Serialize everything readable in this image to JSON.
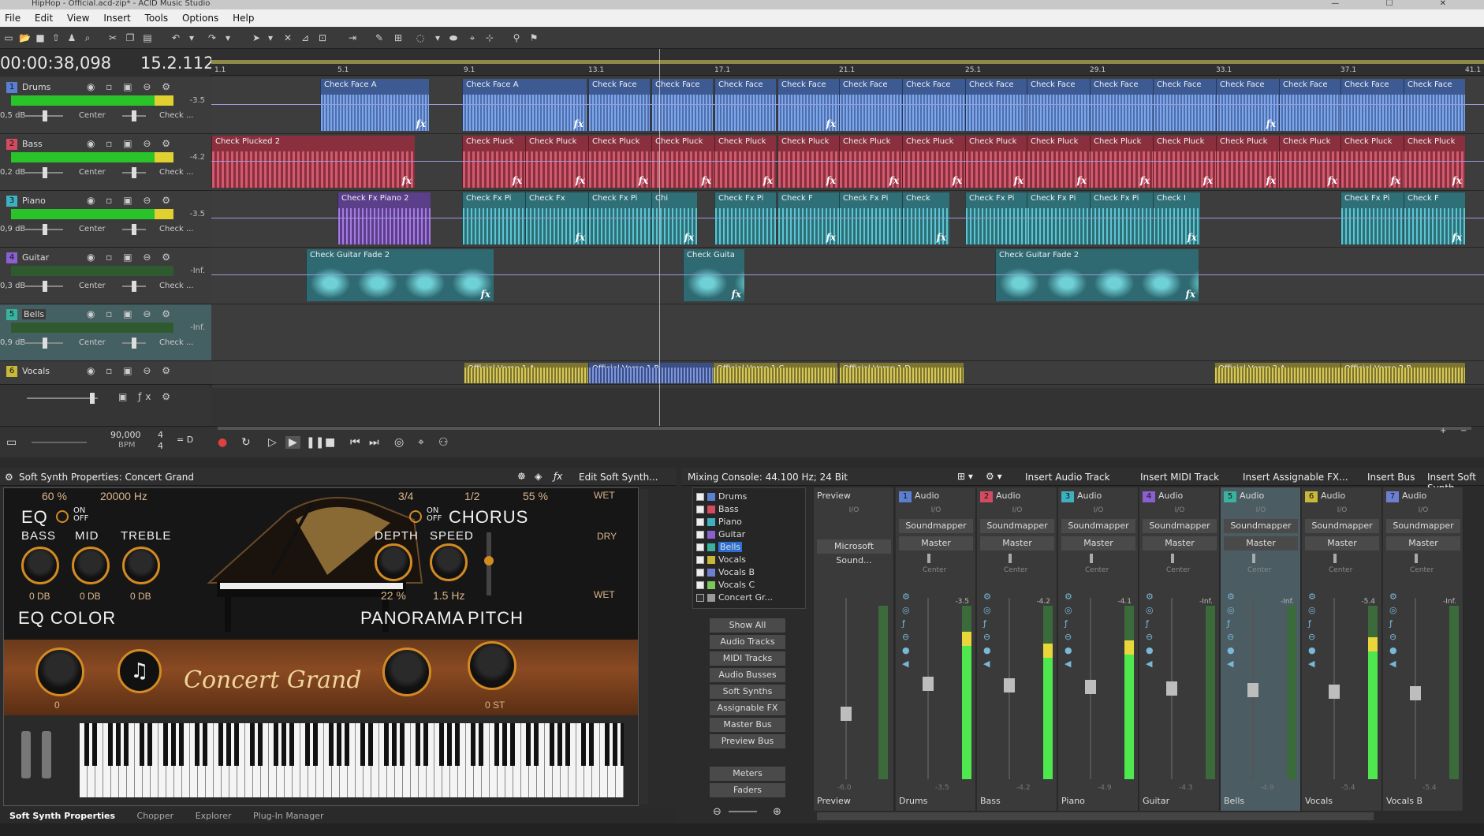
{
  "title_bar": {
    "title": "HipHop - Official.acd-zip* - ACID Music Studio",
    "window_controls": "— ☐ ✕"
  },
  "menu": [
    "File",
    "Edit",
    "View",
    "Insert",
    "Tools",
    "Options",
    "Help"
  ],
  "timeline": {
    "timecode": "00:00:38,098",
    "measure": "15.2.112",
    "ruler": [
      "1.1",
      "5.1",
      "9.1",
      "13.1",
      "17.1",
      "21.1",
      "25.1",
      "29.1",
      "33.1",
      "37.1",
      "41.1"
    ]
  },
  "tracks": [
    {
      "num": "1",
      "name": "Drums",
      "color": "#5a7fd1",
      "db": "0,5 dB",
      "peak": "-3.5",
      "pan": "Center",
      "fx": "Check ..."
    },
    {
      "num": "2",
      "name": "Bass",
      "color": "#d24b60",
      "db": "0,2 dB",
      "peak": "-4.2",
      "pan": "Center",
      "fx": "Check ..."
    },
    {
      "num": "3",
      "name": "Piano",
      "color": "#3fb0be",
      "db": "0,9 dB",
      "peak": "-3.5",
      "pan": "Center",
      "fx": "Check ..."
    },
    {
      "num": "4",
      "name": "Guitar",
      "color": "#8a5fd0",
      "db": "0,3 dB",
      "peak": "-Inf.",
      "pan": "Center",
      "fx": "Check ..."
    },
    {
      "num": "5",
      "name": "Bells",
      "color": "#3ab2a0",
      "db": "0,9 dB",
      "peak": "-Inf.",
      "pan": "Center",
      "fx": "Check ..."
    },
    {
      "num": "6",
      "name": "Vocals",
      "color": "#c8b83a",
      "db": "",
      "peak": "",
      "pan": "",
      "fx": ""
    }
  ],
  "clips": {
    "drums": [
      "Check Face A",
      "Check Face A",
      "Check Face",
      "Check Face",
      "Check Face",
      "Check Face",
      "Check Face",
      "Check Face",
      "Check Face",
      "Check Face",
      "Check Face",
      "Check Face",
      "Check Face",
      "Check Face",
      "Check Face",
      "Check Face",
      "Check Face"
    ],
    "bass": [
      "Check Plucked 2",
      "Check Pluck",
      "Check Pluck",
      "Check Pluck",
      "Check Pluck",
      "Check Pluck",
      "Check Pluck",
      "Check Pluck",
      "Check Pluck",
      "Check Pluck",
      "Check Pluck",
      "Check Pluck",
      "Check Pluck",
      "Check Pluck",
      "Check Pluck",
      "Check Pluck",
      "Check Pluck",
      "Check Pluck",
      "Check Pluck",
      "Check Pluck"
    ],
    "piano": [
      "Check Fx Piano 2",
      "Check Fx Pi",
      "Check Fx",
      "Check Fx Pi",
      "Chi",
      "Check Fx Pi",
      "Check F",
      "Check Fx Pi",
      "Check",
      "Check Fx Pi",
      "Check Fx Pi",
      "Check Fx Pi",
      "Check I",
      "Check Fx Pi",
      "Check F"
    ],
    "guitar": [
      "Check Guitar Fade 2",
      "Check Guita",
      "Check Guitar Fade 2"
    ],
    "vocals": [
      "Official Verse 1 A",
      "Official Verse 1 B",
      "Official Verse 1 C",
      "Official Verse 1 D",
      "Official Verse 2 A",
      "Official Verse 2 B"
    ]
  },
  "transport": {
    "bpm_value": "90,000",
    "bpm_label": "BPM",
    "sig_top": "4",
    "sig_bottom": "4",
    "sig_extra": "= D"
  },
  "soft_synth": {
    "header": "Soft Synth Properties: Concert Grand",
    "edit_button": "Edit Soft Synth...",
    "top_values": [
      "60 %",
      "20000 Hz",
      "3/4",
      "1/2",
      "55 %"
    ],
    "wet": "WET",
    "dry": "DRY",
    "eq": "EQ",
    "chorus": "CHORUS",
    "on": "ON",
    "off": "OFF",
    "bass": "BASS",
    "mid": "MID",
    "treble": "TREBLE",
    "bass_val": "0 DB",
    "mid_val": "0 DB",
    "treble_val": "0 DB",
    "depth": "DEPTH",
    "speed": "SPEED",
    "depth_val": "22 %",
    "speed_val": "1.5 Hz",
    "eq_color": "EQ COLOR",
    "eq_color_val": "0",
    "panorama": "PANORAMA",
    "pitch": "PITCH",
    "pitch_val": "0 ST",
    "instrument": "Concert Grand"
  },
  "bottom_tabs": [
    "Soft Synth Properties",
    "Chopper",
    "Explorer",
    "Plug-In Manager"
  ],
  "mixer": {
    "header": "Mixing Console: 44.100 Hz; 24 Bit",
    "actions": [
      "Insert Audio Track",
      "Insert MIDI Track",
      "Insert Assignable FX...",
      "Insert Bus",
      "Insert Soft Synth..."
    ],
    "list": [
      {
        "num": "1",
        "name": "Drums",
        "color": "#5a7fd1"
      },
      {
        "num": "2",
        "name": "Bass",
        "color": "#d24b60"
      },
      {
        "num": "3",
        "name": "Piano",
        "color": "#3fb0be"
      },
      {
        "num": "4",
        "name": "Guitar",
        "color": "#8a5fd0"
      },
      {
        "num": "5",
        "name": "Bells",
        "color": "#3ab2a0"
      },
      {
        "num": "6",
        "name": "Vocals",
        "color": "#c8b83a"
      },
      {
        "num": "7",
        "name": "Vocals B",
        "color": "#6f7fd0"
      },
      {
        "num": "8",
        "name": "Vocals C",
        "color": "#7ac85a"
      },
      {
        "num": "",
        "name": "Concert Gr...",
        "color": "#999999"
      }
    ],
    "buttons": [
      "Show All",
      "Audio Tracks",
      "MIDI Tracks",
      "Audio Busses",
      "Soft Synths",
      "Assignable FX",
      "Master Bus",
      "Preview Bus"
    ],
    "buttons2": [
      "Meters",
      "Faders"
    ],
    "preview": {
      "label": "Preview",
      "io": "I/O",
      "device": "Microsoft Sound...",
      "footer": "Preview",
      "bottom_value": "-6.0"
    },
    "strips": [
      {
        "num": "1",
        "type": "Audio",
        "name": "Drums",
        "color": "#5a7fd1",
        "io": "I/O",
        "sound": "Soundmapper",
        "master": "Master",
        "center": "Center",
        "peak": "-3.5",
        "bottom": "-3.5",
        "level": 0.85
      },
      {
        "num": "2",
        "type": "Audio",
        "name": "Bass",
        "color": "#d24b60",
        "io": "I/O",
        "sound": "Soundmapper",
        "master": "Master",
        "center": "Center",
        "peak": "-4.2",
        "bottom": "-4.2",
        "level": 0.78
      },
      {
        "num": "3",
        "type": "Audio",
        "name": "Piano",
        "color": "#3fb0be",
        "io": "I/O",
        "sound": "Soundmapper",
        "master": "Master",
        "center": "Center",
        "peak": "-4.1",
        "bottom": "-4.9",
        "level": 0.8
      },
      {
        "num": "4",
        "type": "Audio",
        "name": "Guitar",
        "color": "#8a5fd0",
        "io": "I/O",
        "sound": "Soundmapper",
        "master": "Master",
        "center": "Center",
        "peak": "-Inf.",
        "bottom": "-4.3",
        "level": 0.0
      },
      {
        "num": "5",
        "type": "Audio",
        "name": "Bells",
        "color": "#3ab2a0",
        "io": "I/O",
        "sound": "Soundmapper",
        "master": "Master",
        "center": "Center",
        "peak": "-Inf.",
        "bottom": "-4.9",
        "level": 0.0
      },
      {
        "num": "6",
        "type": "Audio",
        "name": "Vocals",
        "color": "#c8b83a",
        "io": "I/O",
        "sound": "Soundmapper",
        "master": "Master",
        "center": "Center",
        "peak": "-5.4",
        "bottom": "-5.4",
        "level": 0.82
      },
      {
        "num": "7",
        "type": "Audio",
        "name": "Vocals B",
        "color": "#6f7fd0",
        "io": "I/O",
        "sound": "Soundmapper",
        "master": "Master",
        "center": "Center",
        "peak": "-Inf.",
        "bottom": "-5.4",
        "level": 0.0
      }
    ]
  }
}
